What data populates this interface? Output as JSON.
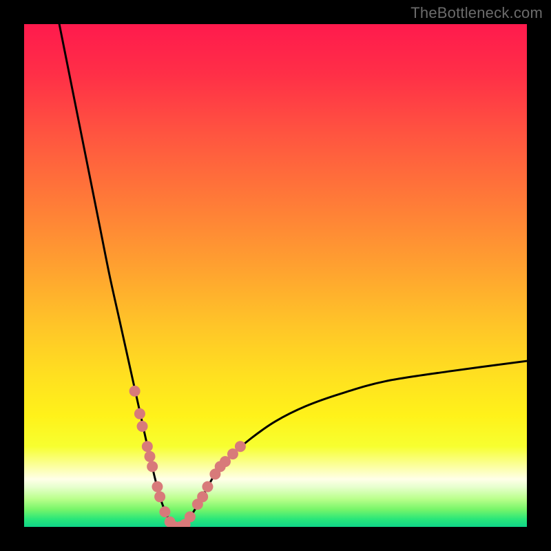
{
  "watermark": "TheBottleneck.com",
  "colors": {
    "bg": "#000000",
    "curve": "#000000",
    "marker_fill": "#d87a7a",
    "marker_stroke": "#b05050",
    "grad_stops": [
      {
        "offset": 0.0,
        "color": "#ff1a4d"
      },
      {
        "offset": 0.1,
        "color": "#ff2f47"
      },
      {
        "offset": 0.22,
        "color": "#ff5540"
      },
      {
        "offset": 0.35,
        "color": "#ff7a38"
      },
      {
        "offset": 0.48,
        "color": "#ffa030"
      },
      {
        "offset": 0.6,
        "color": "#ffc528"
      },
      {
        "offset": 0.7,
        "color": "#ffe020"
      },
      {
        "offset": 0.78,
        "color": "#fff21a"
      },
      {
        "offset": 0.84,
        "color": "#f7ff30"
      },
      {
        "offset": 0.885,
        "color": "#fcffb0"
      },
      {
        "offset": 0.905,
        "color": "#ffffe8"
      },
      {
        "offset": 0.92,
        "color": "#e8ffcf"
      },
      {
        "offset": 0.945,
        "color": "#b8ff8a"
      },
      {
        "offset": 0.965,
        "color": "#78f56a"
      },
      {
        "offset": 0.985,
        "color": "#28e67a"
      },
      {
        "offset": 1.0,
        "color": "#0fd488"
      }
    ]
  },
  "chart_data": {
    "type": "line",
    "title": "",
    "xlabel": "",
    "ylabel": "",
    "x_range": [
      0,
      100
    ],
    "y_range": [
      0,
      100
    ],
    "x_optimum": 30,
    "curve_note": "V-shaped bottleneck curve; minimum (0%) at x≈30, rising sharply on both sides; left branch reaches y≈100 at x≈7; right branch reaches y≈33 at x≈100.",
    "series": [
      {
        "name": "bottleneck-curve",
        "points": [
          {
            "x": 7.0,
            "y": 100.0
          },
          {
            "x": 9.0,
            "y": 90.0
          },
          {
            "x": 11.0,
            "y": 80.0
          },
          {
            "x": 13.0,
            "y": 70.0
          },
          {
            "x": 15.0,
            "y": 60.0
          },
          {
            "x": 17.0,
            "y": 50.0
          },
          {
            "x": 19.0,
            "y": 41.0
          },
          {
            "x": 21.0,
            "y": 32.0
          },
          {
            "x": 23.0,
            "y": 23.0
          },
          {
            "x": 25.0,
            "y": 14.0
          },
          {
            "x": 27.0,
            "y": 6.0
          },
          {
            "x": 29.0,
            "y": 1.0
          },
          {
            "x": 30.0,
            "y": 0.0
          },
          {
            "x": 31.0,
            "y": 0.0
          },
          {
            "x": 32.0,
            "y": 0.5
          },
          {
            "x": 34.0,
            "y": 3.5
          },
          {
            "x": 36.0,
            "y": 7.0
          },
          {
            "x": 38.0,
            "y": 10.5
          },
          {
            "x": 41.0,
            "y": 14.0
          },
          {
            "x": 45.0,
            "y": 17.5
          },
          {
            "x": 50.0,
            "y": 21.0
          },
          {
            "x": 56.0,
            "y": 24.0
          },
          {
            "x": 63.0,
            "y": 26.5
          },
          {
            "x": 72.0,
            "y": 29.0
          },
          {
            "x": 85.0,
            "y": 31.0
          },
          {
            "x": 100.0,
            "y": 33.0
          }
        ]
      },
      {
        "name": "highlight-markers",
        "note": "Salmon dots clustered around the trough of the V (tested configurations near the optimal match).",
        "points": [
          {
            "x": 22.0,
            "y": 27.0
          },
          {
            "x": 23.0,
            "y": 22.5
          },
          {
            "x": 23.5,
            "y": 20.0
          },
          {
            "x": 24.5,
            "y": 16.0
          },
          {
            "x": 25.0,
            "y": 14.0
          },
          {
            "x": 25.5,
            "y": 12.0
          },
          {
            "x": 26.5,
            "y": 8.0
          },
          {
            "x": 27.0,
            "y": 6.0
          },
          {
            "x": 28.0,
            "y": 3.0
          },
          {
            "x": 29.0,
            "y": 1.0
          },
          {
            "x": 30.0,
            "y": 0.0
          },
          {
            "x": 31.0,
            "y": 0.0
          },
          {
            "x": 32.0,
            "y": 0.5
          },
          {
            "x": 33.0,
            "y": 2.0
          },
          {
            "x": 34.5,
            "y": 4.5
          },
          {
            "x": 35.5,
            "y": 6.0
          },
          {
            "x": 36.5,
            "y": 8.0
          },
          {
            "x": 38.0,
            "y": 10.5
          },
          {
            "x": 39.0,
            "y": 12.0
          },
          {
            "x": 40.0,
            "y": 13.0
          },
          {
            "x": 41.5,
            "y": 14.5
          },
          {
            "x": 43.0,
            "y": 16.0
          }
        ]
      }
    ]
  }
}
